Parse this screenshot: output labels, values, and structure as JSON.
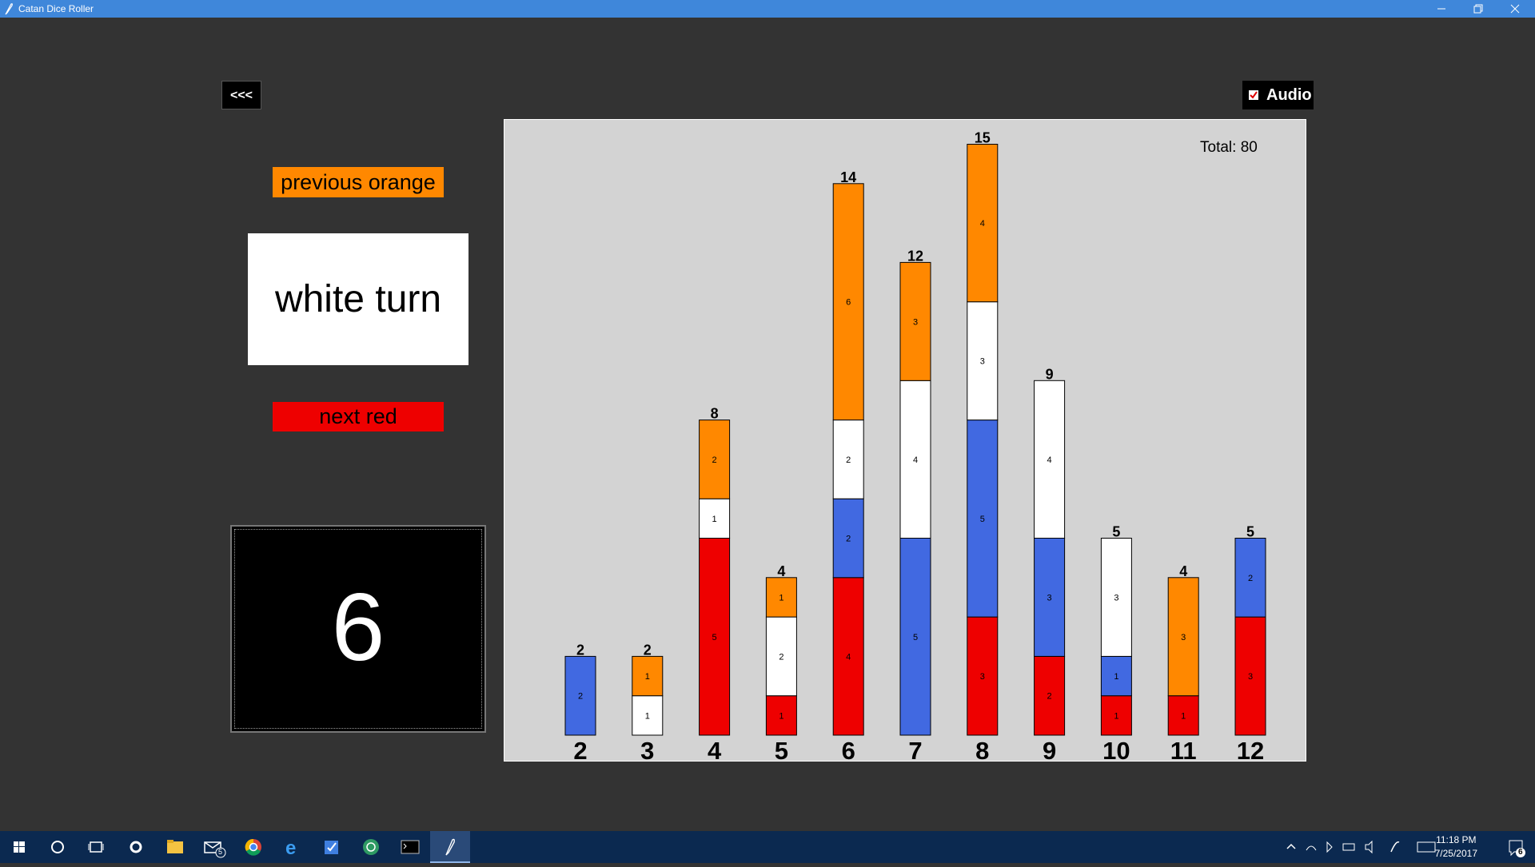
{
  "window": {
    "title": "Catan Dice Roller"
  },
  "controls": {
    "back_label": "<<<",
    "audio_label": "Audio",
    "audio_checked": true,
    "previous_label": "previous orange",
    "turn_label": "white turn",
    "next_label": "next red",
    "dice_value": "6"
  },
  "colors": {
    "red": "#ee0000",
    "blue": "#4169e1",
    "white": "#ffffff",
    "orange": "#ff8800"
  },
  "chart_data": {
    "type": "bar",
    "stacked": true,
    "total_label": "Total: 80",
    "categories": [
      "2",
      "3",
      "4",
      "5",
      "6",
      "7",
      "8",
      "9",
      "10",
      "11",
      "12"
    ],
    "totals": [
      2,
      2,
      8,
      4,
      14,
      12,
      15,
      9,
      5,
      4,
      5
    ],
    "series": [
      {
        "color": "red",
        "values": [
          0,
          0,
          5,
          1,
          4,
          0,
          3,
          2,
          1,
          1,
          3
        ]
      },
      {
        "color": "blue",
        "values": [
          2,
          0,
          0,
          0,
          2,
          5,
          5,
          3,
          1,
          0,
          2
        ]
      },
      {
        "color": "white",
        "values": [
          0,
          1,
          1,
          2,
          2,
          4,
          3,
          4,
          3,
          0,
          0
        ]
      },
      {
        "color": "orange",
        "values": [
          0,
          1,
          2,
          1,
          6,
          3,
          4,
          0,
          0,
          3,
          0
        ]
      }
    ],
    "ylim": [
      0,
      16
    ]
  },
  "taskbar": {
    "time": "11:18 PM",
    "date": "7/25/2017",
    "mail_badge": "5",
    "notif_badge": "6"
  }
}
